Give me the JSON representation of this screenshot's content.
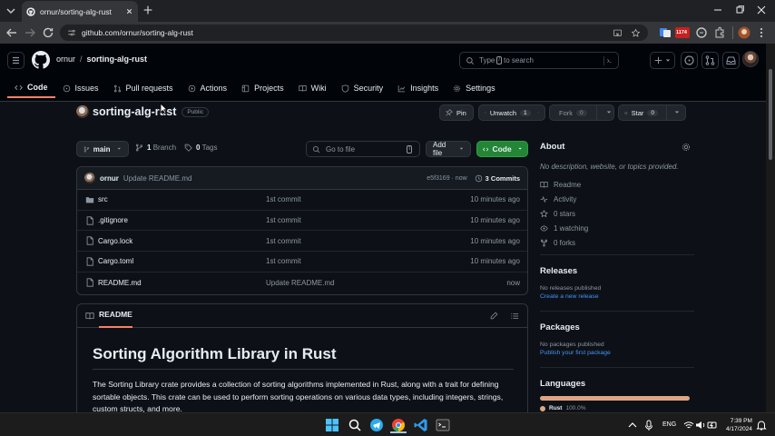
{
  "browser": {
    "tab_title": "ornur/sorting-alg-rust",
    "url": "github.com/ornur/sorting-alg-rust",
    "badge": "1174"
  },
  "github": {
    "owner": "ornur",
    "repo": "sorting-alg-rust",
    "search_pre": "Type",
    "search_key": "/",
    "search_post": "to search",
    "tabs": [
      {
        "label": "Code",
        "icon": "code-icon"
      },
      {
        "label": "Issues",
        "icon": "issue-icon"
      },
      {
        "label": "Pull requests",
        "icon": "pull-request-icon"
      },
      {
        "label": "Actions",
        "icon": "actions-icon"
      },
      {
        "label": "Projects",
        "icon": "projects-icon"
      },
      {
        "label": "Wiki",
        "icon": "book-icon"
      },
      {
        "label": "Security",
        "icon": "shield-icon"
      },
      {
        "label": "Insights",
        "icon": "graph-icon"
      },
      {
        "label": "Settings",
        "icon": "gear-icon"
      }
    ]
  },
  "repo": {
    "name": "sorting-alg-rust",
    "visibility": "Public",
    "pin": "Pin",
    "unwatch": "Unwatch",
    "watch_count": "1",
    "fork": "Fork",
    "fork_count": "0",
    "star": "Star",
    "star_count": "0"
  },
  "toolbar": {
    "branch": "main",
    "branches_count": "1",
    "branches_label": "Branch",
    "tags_count": "0",
    "tags_label": "Tags",
    "goto_placeholder": "Go to file",
    "goto_key": "t",
    "add_file": "Add file",
    "code": "Code"
  },
  "commit": {
    "author": "ornur",
    "message": "Update README.md",
    "hash_time": "e5f3169 · now",
    "commits": "3 Commits"
  },
  "files": [
    {
      "name": "src",
      "type": "folder",
      "commit": "1st commit",
      "time": "10 minutes ago"
    },
    {
      "name": ".gitignore",
      "type": "file",
      "commit": "1st commit",
      "time": "10 minutes ago"
    },
    {
      "name": "Cargo.lock",
      "type": "file",
      "commit": "1st commit",
      "time": "10 minutes ago"
    },
    {
      "name": "Cargo.toml",
      "type": "file",
      "commit": "1st commit",
      "time": "10 minutes ago"
    },
    {
      "name": "README.md",
      "type": "file",
      "commit": "Update README.md",
      "time": "now"
    }
  ],
  "readme": {
    "tab": "README",
    "title": "Sorting Algorithm Library in Rust",
    "paragraph": "The Sorting Library crate provides a collection of sorting algorithms implemented in Rust, along with a trait for defining sortable objects. This crate can be used to perform sorting operations on various data types, including integers, strings, custom structs, and more."
  },
  "about": {
    "heading": "About",
    "description": "No description, website, or topics provided.",
    "items": [
      {
        "label": "Readme",
        "icon": "book-icon"
      },
      {
        "label": "Activity",
        "icon": "pulse-icon"
      },
      {
        "label": "0 stars",
        "icon": "star-icon"
      },
      {
        "label": "1 watching",
        "icon": "eye-icon"
      },
      {
        "label": "0 forks",
        "icon": "fork-icon"
      }
    ],
    "releases_heading": "Releases",
    "releases_text": "No releases published",
    "releases_link": "Create a new release",
    "packages_heading": "Packages",
    "packages_text": "No packages published",
    "packages_link": "Publish your first package",
    "languages_heading": "Languages",
    "language": "Rust",
    "language_pct": "100.0%",
    "language_color": "#dea584"
  },
  "taskbar": {
    "lang": "ENG",
    "time": "7:39 PM",
    "date": "4/17/2024"
  }
}
